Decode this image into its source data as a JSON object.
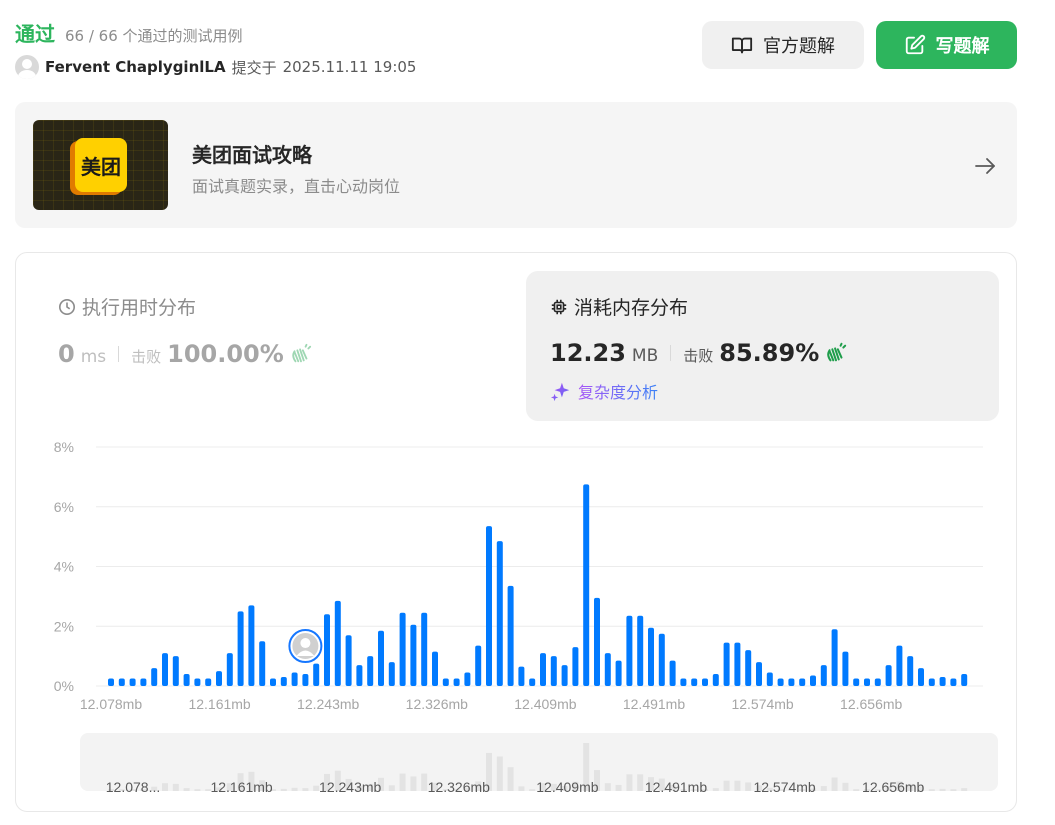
{
  "header": {
    "status": "通过",
    "cases": "66 / 66 个通过的测试用例",
    "user": "Fervent ChaplyginlLA",
    "submit_label": "提交于",
    "submit_time": "2025.11.11 19:05",
    "official_btn": "官方题解",
    "write_btn": "写题解"
  },
  "banner": {
    "logo_text": "美团",
    "title": "美团面试攻略",
    "subtitle": "面试真题实录，直击心动岗位"
  },
  "runtime": {
    "title": "执行用时分布",
    "value": "0",
    "unit": "ms",
    "beat_label": "击败",
    "beat_pct": "100.00%"
  },
  "memory": {
    "title": "消耗内存分布",
    "value": "12.23",
    "unit": "MB",
    "beat_label": "击败",
    "beat_pct": "85.89%",
    "complexity_link": "复杂度分析"
  },
  "colors": {
    "accent_green": "#2db55d",
    "bar_blue": "#007aff",
    "muted_gray": "#a6a6a6"
  },
  "chart_data": {
    "type": "bar",
    "ylim": [
      0,
      8
    ],
    "yticks": [
      "8%",
      "6%",
      "4%",
      "2%",
      "0%"
    ],
    "ytick_values": [
      8,
      6,
      4,
      2,
      0
    ],
    "xtick_labels": [
      "12.078mb",
      "12.161mb",
      "12.243mb",
      "12.326mb",
      "12.409mb",
      "12.491mb",
      "12.574mb",
      "12.656mb"
    ],
    "minimap_xtick_labels": [
      "12.078...",
      "12.161mb",
      "12.243mb",
      "12.326mb",
      "12.409mb",
      "12.491mb",
      "12.574mb",
      "12.656mb"
    ],
    "values": [
      0.25,
      0.25,
      0.25,
      0.25,
      0.6,
      1.1,
      1.0,
      0.4,
      0.25,
      0.25,
      0.5,
      1.1,
      2.5,
      2.7,
      1.5,
      0.25,
      0.3,
      0.45,
      0.4,
      0.75,
      2.4,
      2.85,
      1.7,
      0.7,
      1.0,
      1.85,
      0.8,
      2.45,
      2.05,
      2.45,
      1.15,
      0.25,
      0.25,
      0.45,
      1.35,
      5.35,
      4.85,
      3.35,
      0.65,
      0.25,
      1.1,
      1.0,
      0.7,
      1.3,
      6.75,
      2.95,
      1.1,
      0.85,
      2.35,
      2.35,
      1.95,
      1.75,
      0.85,
      0.25,
      0.25,
      0.25,
      0.4,
      1.45,
      1.45,
      1.2,
      0.8,
      0.45,
      0.25,
      0.25,
      0.25,
      0.35,
      0.7,
      1.9,
      1.15,
      0.25,
      0.25,
      0.25,
      0.7,
      1.35,
      1.0,
      0.6,
      0.25,
      0.3,
      0.25,
      0.4
    ],
    "highlight_index": 18
  }
}
